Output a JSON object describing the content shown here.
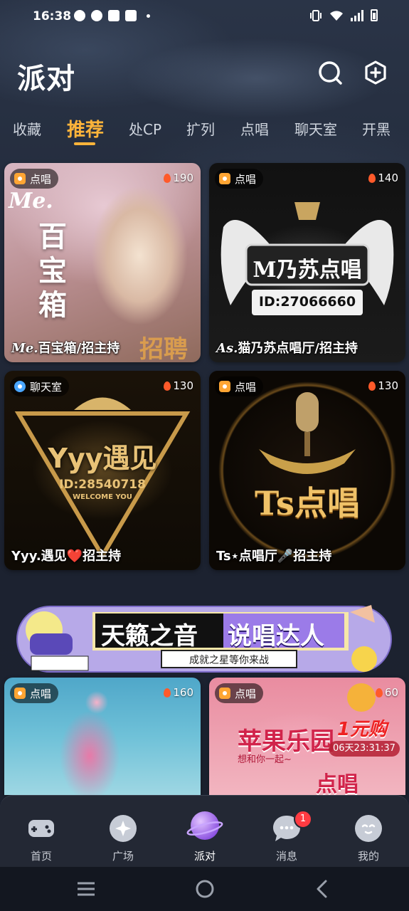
{
  "status_bar": {
    "time": "16:38"
  },
  "header": {
    "title": "派对"
  },
  "tabs": [
    {
      "label": "收藏"
    },
    {
      "label": "推荐",
      "active": true
    },
    {
      "label": "处CP"
    },
    {
      "label": "扩列"
    },
    {
      "label": "点唱"
    },
    {
      "label": "聊天室"
    },
    {
      "label": "开黑"
    }
  ],
  "cards": [
    {
      "tag": "点唱",
      "heat": "190",
      "name_prefix": "Me.",
      "name": "百宝箱/招主持",
      "art_title": "百宝箱",
      "art_extra": "招聘",
      "art_script": "Me."
    },
    {
      "tag": "点唱",
      "heat": "140",
      "name_prefix": "As.",
      "name": "猫乃苏点唱厅/招主持",
      "art_title": "M乃苏点唱",
      "art_id": "ID:27066660"
    },
    {
      "tag": "聊天室",
      "heat": "130",
      "name_prefix": "Yyy.",
      "name": "遇见❤️招主持",
      "art_title": "Yyy遇见",
      "art_id": "ID:28540718",
      "art_sub": "WELCOME YOU"
    },
    {
      "tag": "点唱",
      "heat": "130",
      "name_prefix": "Ts",
      "name": "⋆点唱厅🎤招主持",
      "art_title": "Ts点唱"
    },
    {
      "tag": "点唱",
      "heat": "160",
      "name_prefix": "",
      "name": ""
    },
    {
      "tag": "点唱",
      "heat": "60",
      "name_prefix": "",
      "name": "",
      "art_title": "苹果乐园",
      "art_sub": "想和你一起~",
      "promo": "1元购",
      "countdown": "06天23:31:37",
      "art_bottom": "点唱"
    }
  ],
  "banner": {
    "title_left": "天籁之音",
    "title_right": "说唱达人",
    "subtitle": "成就之星等你来战"
  },
  "bottom_nav": [
    {
      "label": "首页",
      "icon": "gamepad-icon"
    },
    {
      "label": "广场",
      "icon": "sparkle-icon"
    },
    {
      "label": "派对",
      "icon": "planet-icon",
      "active": true
    },
    {
      "label": "消息",
      "icon": "chat-bubble-icon",
      "badge": "1"
    },
    {
      "label": "我的",
      "icon": "face-icon"
    }
  ],
  "colors": {
    "accent": "#ffb43a",
    "badge": "#ff3b42",
    "nav_bg": "#232834"
  }
}
